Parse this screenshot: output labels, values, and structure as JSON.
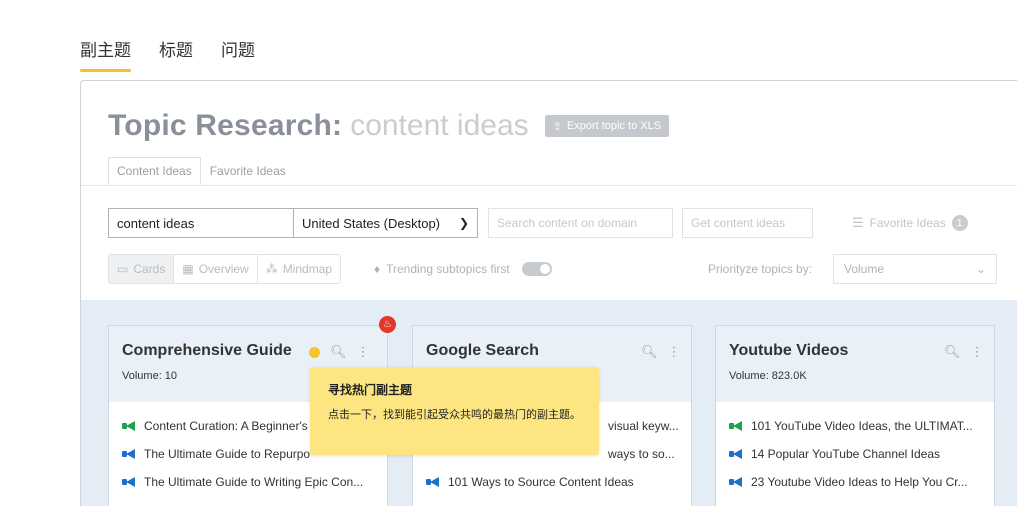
{
  "top_tabs": [
    "副主题",
    "标题",
    "问题"
  ],
  "header": {
    "title_main": "Topic Research:",
    "title_query": "content ideas",
    "export_label": "Export topic to XLS"
  },
  "sub_tabs": [
    "Content Ideas",
    "Favorite Ideas"
  ],
  "search": {
    "topic_value": "content ideas",
    "location_value": "United States (Desktop)",
    "domain_placeholder": "Search content on domain",
    "get_ideas_label": "Get content ideas",
    "favorite_label": "Favorite Ideas",
    "favorite_count": "1"
  },
  "views": {
    "cards": "Cards",
    "overview": "Overview",
    "mindmap": "Mindmap",
    "trending_label": "Trending subtopics first",
    "prioritize_label": "Priorityze topics by:",
    "prioritize_value": "Volume"
  },
  "cards": [
    {
      "title": "Comprehensive Guide",
      "volume": "Volume: 10",
      "items": [
        {
          "text": "Content Curation: A Beginner's",
          "icon": "green"
        },
        {
          "text": "The Ultimate Guide to Repurpo",
          "icon": "blue"
        },
        {
          "text": "The Ultimate Guide to Writing Epic Con...",
          "icon": "blue"
        }
      ]
    },
    {
      "title": "Google Search",
      "volume": "",
      "items": [
        {
          "text": "visual keyw...",
          "icon": "blue"
        },
        {
          "text": "ways to so...",
          "icon": "blue"
        },
        {
          "text": "101 Ways to Source Content Ideas",
          "icon": "blue"
        }
      ]
    },
    {
      "title": "Youtube Videos",
      "volume": "Volume: 823.0K",
      "items": [
        {
          "text": "101 YouTube Video Ideas, the ULTIMAT...",
          "icon": "green"
        },
        {
          "text": "14 Popular YouTube Channel Ideas",
          "icon": "blue"
        },
        {
          "text": "23 Youtube Video Ideas to Help You Cr...",
          "icon": "blue"
        }
      ]
    }
  ],
  "tooltip": {
    "title": "寻找热门副主题",
    "body": "点击一下，找到能引起受众共鸣的最热门的副主题。"
  },
  "colors": {
    "accent_yellow": "#f3c227",
    "tooltip_bg": "#fde681",
    "fire_red": "#e0382b",
    "card_area_bg": "#e4ecf6"
  }
}
